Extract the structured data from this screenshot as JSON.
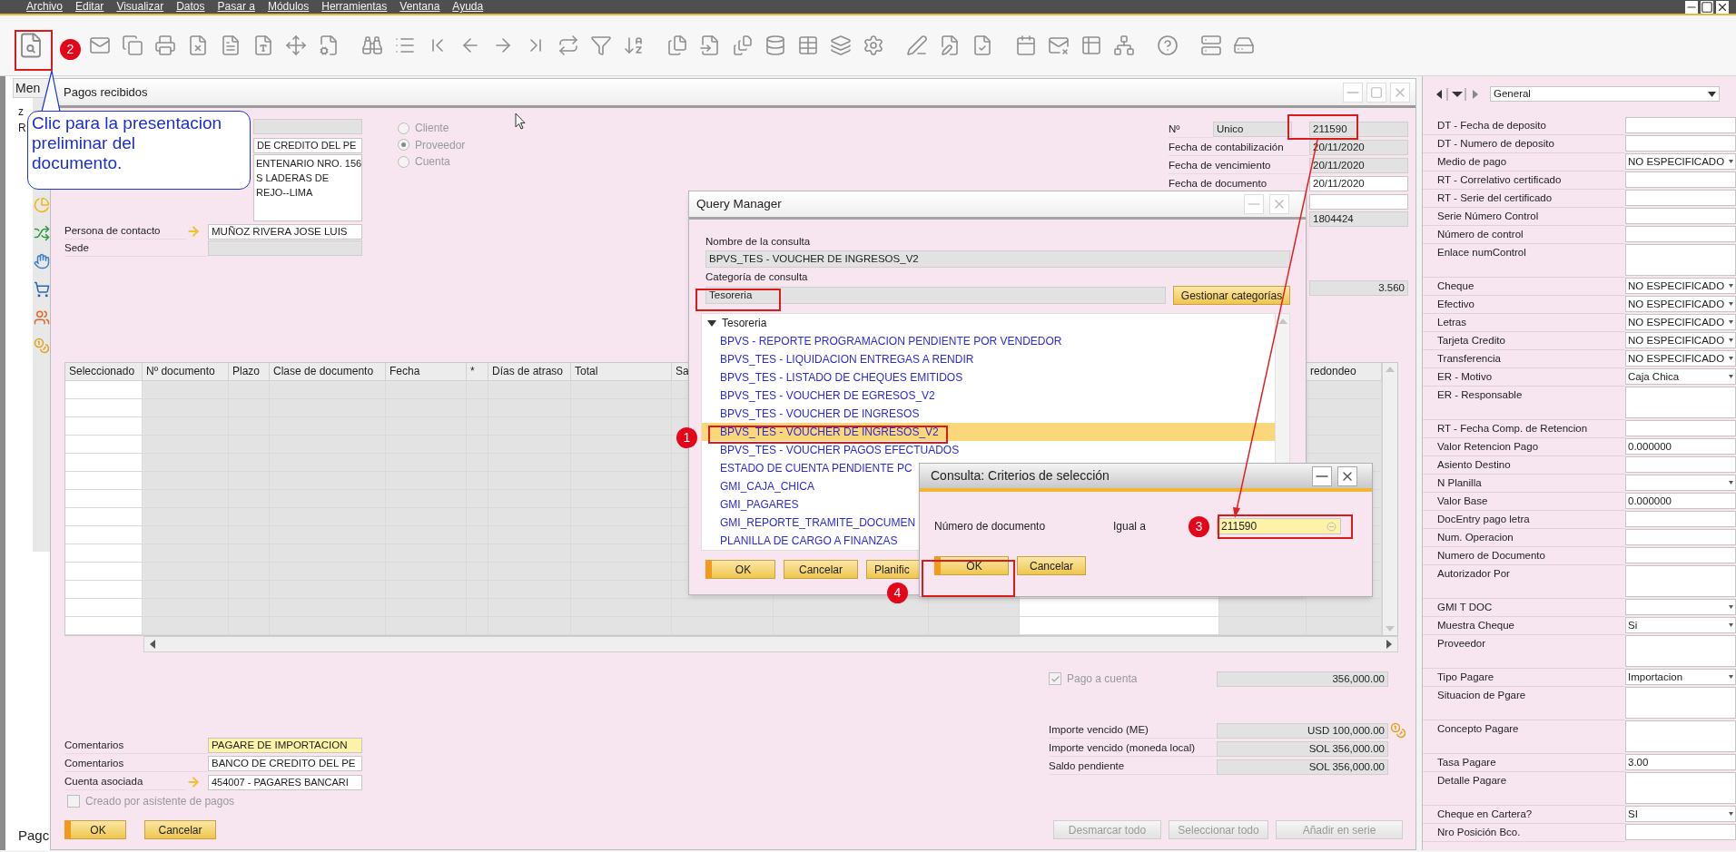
{
  "menu_bar": {
    "items": [
      "Archivo",
      "Editar",
      "Visualizar",
      "Datos",
      "Pasar a",
      "Módulos",
      "Herramientas",
      "Ventana",
      "Ayuda"
    ]
  },
  "side_menu": {
    "tab": "Men",
    "letters": [
      "z",
      "R"
    ],
    "bottom_tab": "Pagc"
  },
  "form": {
    "title": "Pagos recibidos",
    "partner": {
      "name": "DE CREDITO DEL PE",
      "address": [
        "ENTENARIO NRO. 156",
        "S LADERAS DE",
        "REJO--LIMA"
      ]
    },
    "contact": {
      "label": "Persona de contacto",
      "value": "MUÑOZ RIVERA JOSE LUIS"
    },
    "branch": {
      "label": "Sede"
    },
    "partner_type": [
      {
        "label": "Cliente",
        "selected": false,
        "disabled": true
      },
      {
        "label": "Proveedor",
        "selected": true,
        "disabled": true
      },
      {
        "label": "Cuenta",
        "selected": false,
        "disabled": true
      }
    ],
    "number": {
      "label": "Nº",
      "series": "Unico",
      "value": "211590"
    },
    "dates": [
      {
        "label": "Fecha de contabilización",
        "value": "20/11/2020",
        "editable": false
      },
      {
        "label": "Fecha de vencimiento",
        "value": "20/11/2020",
        "editable": false
      },
      {
        "label": "Fecha de documento",
        "value": "20/11/2020",
        "editable": true
      }
    ],
    "reference": "1804424",
    "rate": "3.560",
    "table": {
      "columns": [
        "Seleccionado",
        "Nº documento",
        "Plazo",
        "Clase de documento",
        "Fecha",
        "*",
        "Días de atraso",
        "Total",
        "Sa",
        "redondeo"
      ]
    },
    "remarks": [
      {
        "label": "Comentarios",
        "value": "PAGARE DE IMPORTACION",
        "highlighted": true
      },
      {
        "label": "Comentarios",
        "value": "BANCO DE CREDITO DEL PE",
        "highlighted": false
      }
    ],
    "account": {
      "label": "Cuenta asociada",
      "value": "454007 - PAGARES BANCARI"
    },
    "wizard": {
      "label": "Creado por asistente de pagos",
      "checked": false,
      "disabled": true
    },
    "buttons": [
      {
        "label": "OK",
        "kind": "primary"
      },
      {
        "label": "Cancelar",
        "kind": "secondary"
      }
    ],
    "on_account": {
      "label": "Pago a cuenta",
      "checked": true,
      "disabled": true,
      "amount": "356,000.00"
    },
    "totals": [
      {
        "label": "Importe vencido (ME)",
        "value": "USD 100,000.00",
        "rate_icon": true
      },
      {
        "label": "Importe vencido (moneda local)",
        "value": "SOL 356,000.00",
        "rate_icon": false
      },
      {
        "label": "Saldo pendiente",
        "value": "SOL 356,000.00",
        "rate_icon": false
      }
    ],
    "bulk_buttons": [
      {
        "label": "Desmarcar todo",
        "disabled": true
      },
      {
        "label": "Seleccionar todo",
        "disabled": true
      },
      {
        "label": "Añadir en serie",
        "disabled": true
      }
    ]
  },
  "udf_panel": {
    "category": "General",
    "fields": [
      {
        "label": "DT - Fecha de deposito",
        "kind": "text"
      },
      {
        "label": "DT - Numero de deposito",
        "kind": "text"
      },
      {
        "label": "Medio de pago",
        "kind": "dropdown",
        "value": "NO ESPECIFICADO"
      },
      {
        "label": "RT - Correlativo certificado",
        "kind": "text"
      },
      {
        "label": "RT - Serie del certificado",
        "kind": "text"
      },
      {
        "label": "Serie Número Control",
        "kind": "text"
      },
      {
        "label": "Número de control",
        "kind": "text"
      },
      {
        "label": "Enlace numControl",
        "kind": "memo"
      },
      {
        "label": "Cheque",
        "kind": "dropdown",
        "value": "NO ESPECIFICADO"
      },
      {
        "label": "Efectivo",
        "kind": "dropdown",
        "value": "NO ESPECIFICADO"
      },
      {
        "label": "Letras",
        "kind": "dropdown",
        "value": "NO ESPECIFICADO"
      },
      {
        "label": "Tarjeta Credito",
        "kind": "dropdown",
        "value": "NO ESPECIFICADO"
      },
      {
        "label": "Transferencia",
        "kind": "dropdown",
        "value": "NO ESPECIFICADO"
      },
      {
        "label": "ER - Motivo",
        "kind": "dropdown",
        "value": "Caja Chica"
      },
      {
        "label": "ER - Responsable",
        "kind": "memo"
      },
      {
        "label": "RT - Fecha Comp. de Retencion",
        "kind": "text"
      },
      {
        "label": "Valor Retencion Pago",
        "kind": "text",
        "value": "0.000000"
      },
      {
        "label": "Asiento Destino",
        "kind": "text"
      },
      {
        "label": "N Planilla",
        "kind": "dropdown"
      },
      {
        "label": "Valor Base",
        "kind": "text",
        "value": "0.000000"
      },
      {
        "label": "DocEntry pago letra",
        "kind": "text"
      },
      {
        "label": "Num. Operacion",
        "kind": "text"
      },
      {
        "label": "Numero de Documento",
        "kind": "text"
      },
      {
        "label": "Autorizador Por",
        "kind": "memo"
      },
      {
        "label": "GMI T DOC",
        "kind": "dropdown"
      },
      {
        "label": "Muestra Cheque",
        "kind": "dropdown",
        "value": "Si"
      },
      {
        "label": "Proveedor",
        "kind": "memo"
      },
      {
        "label": "Tipo Pagare",
        "kind": "dropdown",
        "value": "Importacion"
      },
      {
        "label": "Situacion de Pgare",
        "kind": "memo"
      },
      {
        "label": "Concepto Pagare",
        "kind": "memo"
      },
      {
        "label": "Tasa Pagare",
        "kind": "text",
        "value": "3.00"
      },
      {
        "label": "Detalle Pagare",
        "kind": "memo"
      },
      {
        "label": "Cheque en Cartera?",
        "kind": "dropdown",
        "value": "SI"
      },
      {
        "label": "Nro Posición Bco.",
        "kind": "text"
      }
    ]
  },
  "query_manager": {
    "title": "Query Manager",
    "name_label": "Nombre de la consulta",
    "name": "BPVS_TES - VOUCHER DE INGRESOS_V2",
    "category_label": "Categoría de consulta",
    "category": "Tesoreria",
    "manage_button": "Gestionar categorías",
    "tree": {
      "label": "Tesoreria",
      "expanded": true,
      "children": [
        {
          "label": "BPVS - REPORTE PROGRAMACION PENDIENTE POR VENDEDOR",
          "selected": false
        },
        {
          "label": "BPVS_TES - LIQUIDACION ENTREGAS A RENDIR",
          "selected": false
        },
        {
          "label": "BPVS_TES - LISTADO DE CHEQUES EMITIDOS",
          "selected": false
        },
        {
          "label": "BPVS_TES - VOUCHER DE EGRESOS_V2",
          "selected": false
        },
        {
          "label": "BPVS_TES - VOUCHER DE INGRESOS",
          "selected": false
        },
        {
          "label": "BPVS_TES - VOUCHER DE INGRESOS_V2",
          "selected": true
        },
        {
          "label": "BPVS_TES - VOUCHER PAGOS EFECTUADOS",
          "selected": false
        },
        {
          "label": "ESTADO DE CUENTA PENDIENTE PC",
          "selected": false
        },
        {
          "label": "GMI_CAJA_CHICA",
          "selected": false
        },
        {
          "label": "GMI_PAGARES",
          "selected": false
        },
        {
          "label": "GMI_REPORTE_TRAMITE_DOCUMEN",
          "selected": false
        },
        {
          "label": "PLANILLA DE CARGO A FINANZAS",
          "selected": false
        }
      ]
    },
    "buttons": [
      {
        "label": "OK",
        "kind": "primary"
      },
      {
        "label": "Cancelar",
        "kind": "secondary"
      },
      {
        "label": "Planific",
        "kind": "secondary"
      }
    ]
  },
  "criteria_dialog": {
    "title": "Consulta: Criterios de selección",
    "field_label": "Número de documento",
    "operator": "Igual a",
    "value": "211590",
    "buttons": [
      {
        "label": "OK",
        "kind": "primary"
      },
      {
        "label": "Cancelar",
        "kind": "secondary"
      }
    ]
  },
  "callout": {
    "text": "Clic para la presentacion\npreliminar del\ndocumento."
  },
  "step_markers": [
    "1",
    "2",
    "3",
    "4"
  ]
}
